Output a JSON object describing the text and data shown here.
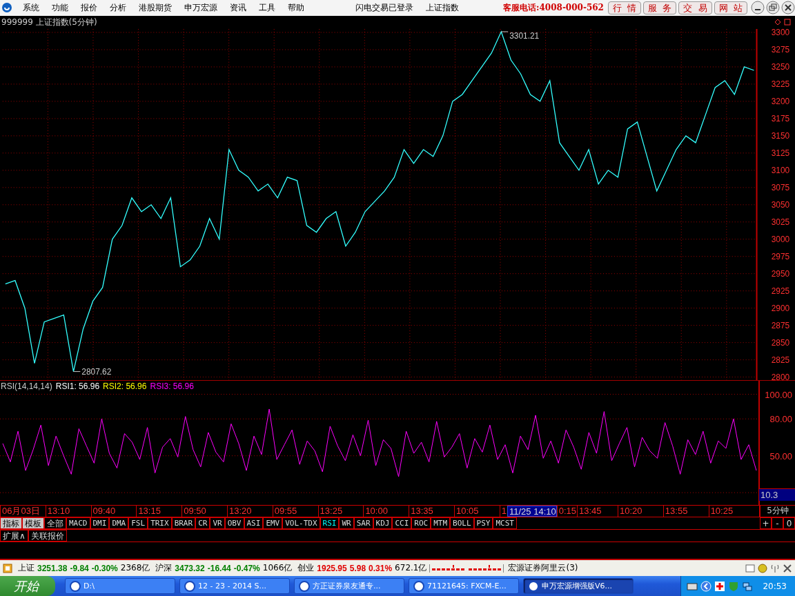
{
  "menu_bar": {
    "items": [
      "系统",
      "功能",
      "报价",
      "分析",
      "港股期货",
      "申万宏源",
      "资讯",
      "工具",
      "帮助"
    ],
    "status": [
      "闪电交易已登录",
      "上证指数"
    ],
    "hotline": "客服电话:4008-000-562",
    "buttons": [
      "行  情",
      "服  务",
      "交  易",
      "网  站"
    ]
  },
  "chart_title": "999999 上证指数(5分钟)",
  "price_chart": {
    "chart_data": {
      "type": "line",
      "ylim": [
        2795,
        3305
      ],
      "grid": true,
      "yticks": [
        2800,
        2825,
        2850,
        2875,
        2900,
        2925,
        2950,
        2975,
        3000,
        3025,
        3050,
        3075,
        3100,
        3125,
        3150,
        3175,
        3200,
        3225,
        3250,
        3275,
        3300
      ],
      "series": [
        {
          "color": "#33ffff",
          "values": [
            2935,
            2940,
            2900,
            2820,
            2880,
            2885,
            2890,
            2808,
            2870,
            2910,
            2930,
            3000,
            3020,
            3060,
            3040,
            3050,
            3030,
            3060,
            2960,
            2970,
            2990,
            3030,
            3000,
            3130,
            3100,
            3090,
            3070,
            3080,
            3060,
            3090,
            3085,
            3020,
            3010,
            3030,
            3040,
            2990,
            3010,
            3040,
            3055,
            3070,
            3090,
            3130,
            3110,
            3130,
            3120,
            3150,
            3200,
            3210,
            3230,
            3250,
            3270,
            3301,
            3260,
            3240,
            3210,
            3200,
            3230,
            3140,
            3120,
            3100,
            3130,
            3080,
            3100,
            3090,
            3160,
            3170,
            3120,
            3070,
            3100,
            3130,
            3150,
            3140,
            3180,
            3220,
            3230,
            3210,
            3250,
            3245
          ]
        }
      ],
      "annotations": [
        {
          "text": "3301.21"
        },
        {
          "text": "2807.62"
        }
      ]
    }
  },
  "rsi_panel": {
    "name": "RSI(14,14,14)",
    "lines": [
      {
        "label": "RSI1: 56.96",
        "color": "#ffffff"
      },
      {
        "label": "RSI2: 56.96",
        "color": "#ffff00"
      },
      {
        "label": "RSI3: 56.96",
        "color": "#ff00ff"
      }
    ],
    "chart_data": {
      "type": "line",
      "ylim": [
        10,
        111
      ],
      "grid": true,
      "yticks": [
        {
          "value": 100,
          "label": "100.00"
        },
        {
          "value": 80,
          "label": "80.00"
        },
        {
          "value": 50,
          "label": "50.00"
        }
      ],
      "series": [
        {
          "color": "#ff00ff",
          "values": [
            60,
            45,
            70,
            38,
            55,
            75,
            42,
            66,
            50,
            35,
            72,
            58,
            44,
            80,
            52,
            40,
            68,
            61,
            47,
            73,
            36,
            57,
            64,
            49,
            82,
            55,
            41,
            69,
            53,
            45,
            76,
            60,
            38,
            66,
            51,
            88,
            47,
            59,
            71,
            43,
            62,
            54,
            37,
            74,
            58,
            46,
            67,
            50,
            79,
            42,
            63,
            56,
            33,
            70,
            52,
            61,
            45,
            78,
            49,
            57,
            68,
            40,
            64,
            53,
            75,
            47,
            59,
            36,
            66,
            55,
            83,
            48,
            62,
            44,
            71,
            57,
            39,
            69,
            52,
            86,
            46,
            60,
            73,
            41,
            65,
            54,
            48,
            77,
            58,
            35,
            63,
            51,
            70,
            44,
            62,
            56,
            80,
            47,
            59,
            38
          ]
        }
      ]
    },
    "cursor_value": "10.3"
  },
  "time_axis": [
    {
      "kind": "tick",
      "text": "06月03日"
    },
    {
      "kind": "tick",
      "text": "13:10"
    },
    {
      "kind": "tick",
      "text": "09:40"
    },
    {
      "kind": "tick",
      "text": "13:15"
    },
    {
      "kind": "tick",
      "text": "09:50"
    },
    {
      "kind": "tick",
      "text": "13:20"
    },
    {
      "kind": "tick",
      "text": "09:55"
    },
    {
      "kind": "tick",
      "text": "13:25"
    },
    {
      "kind": "tick",
      "text": "10:00"
    },
    {
      "kind": "tick",
      "text": "13:35"
    },
    {
      "kind": "tick",
      "text": "10:05"
    },
    {
      "kind": "cut",
      "text": "1"
    },
    {
      "kind": "cursor",
      "text": "11/25 14:10"
    },
    {
      "kind": "cut",
      "text": "0:15"
    },
    {
      "kind": "tick",
      "text": "13:45"
    },
    {
      "kind": "tick",
      "text": "10:20"
    },
    {
      "kind": "tick",
      "text": "13:55"
    },
    {
      "kind": "tick",
      "text": "10:25"
    }
  ],
  "period": "5分钟",
  "indicator_bar": {
    "groups": [
      {
        "label": "指标",
        "selected": true
      },
      {
        "label": "模板",
        "selected": true
      },
      {
        "label": "全部",
        "selected": false
      }
    ],
    "tabs": [
      {
        "label": "MACD",
        "selected": false
      },
      {
        "label": "DMI",
        "selected": false
      },
      {
        "label": "DMA",
        "selected": false
      },
      {
        "label": "FSL",
        "selected": false
      },
      {
        "label": "TRIX",
        "selected": false
      },
      {
        "label": "BRAR",
        "selected": false
      },
      {
        "label": "CR",
        "selected": false
      },
      {
        "label": "VR",
        "selected": false
      },
      {
        "label": "OBV",
        "selected": false
      },
      {
        "label": "ASI",
        "selected": false
      },
      {
        "label": "EMV",
        "selected": false
      },
      {
        "label": "VOL-TDX",
        "selected": false
      },
      {
        "label": "RSI",
        "selected": true
      },
      {
        "label": "WR",
        "selected": false
      },
      {
        "label": "SAR",
        "selected": false
      },
      {
        "label": "KDJ",
        "selected": false
      },
      {
        "label": "CCI",
        "selected": false
      },
      {
        "label": "ROC",
        "selected": false
      },
      {
        "label": "MTM",
        "selected": false
      },
      {
        "label": "BOLL",
        "selected": false
      },
      {
        "label": "PSY",
        "selected": false
      },
      {
        "label": "MCST",
        "selected": false
      }
    ],
    "zoom_buttons": [
      "+",
      "-",
      "0"
    ]
  },
  "extra_tabs": [
    "扩展∧",
    "关联报价"
  ],
  "status_bar": {
    "indices": [
      {
        "name": "上证",
        "price": "3251.38",
        "change": "-9.84",
        "pct": "-0.30%",
        "volume": "2368亿",
        "color": "#008000"
      },
      {
        "name": "沪深",
        "price": "3473.32",
        "change": "-16.44",
        "pct": "-0.47%",
        "volume": "1066亿",
        "color": "#008000"
      },
      {
        "name": "创业",
        "price": "1925.95",
        "change": "5.98",
        "pct": "0.31%",
        "volume": "672.1亿",
        "color": "#e00000"
      }
    ],
    "server": "宏源证券阿里云(3)"
  },
  "taskbar": {
    "start": "开始",
    "tasks": [
      {
        "label": "D:\\",
        "selected": false
      },
      {
        "label": "12 - 23 - 2014 S...",
        "selected": false
      },
      {
        "label": "方正证券泉友通专...",
        "selected": false
      },
      {
        "label": "71121645: FXCM-E...",
        "selected": false
      },
      {
        "label": "申万宏源增强版V6...",
        "selected": true
      }
    ],
    "clock": "20:53"
  }
}
